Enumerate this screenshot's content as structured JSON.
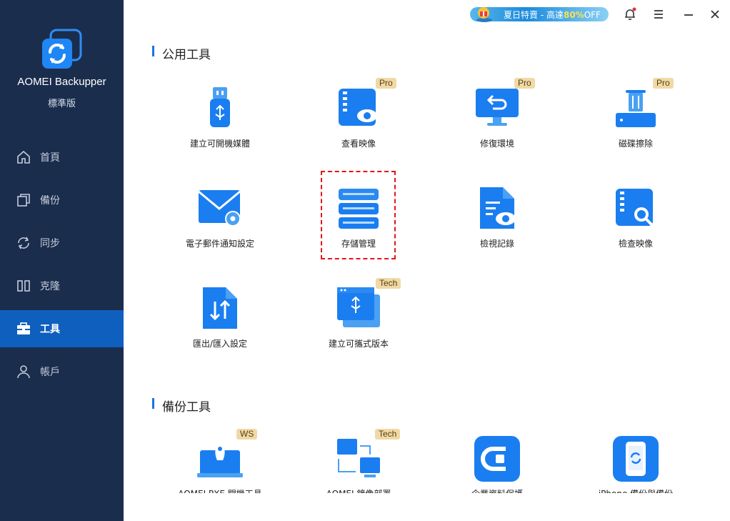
{
  "app": {
    "name": "AOMEI Backupper",
    "edition": "標準版"
  },
  "nav": {
    "items": [
      {
        "label": "首頁",
        "icon": "home-icon"
      },
      {
        "label": "備份",
        "icon": "backup-icon"
      },
      {
        "label": "同步",
        "icon": "sync-icon"
      },
      {
        "label": "克隆",
        "icon": "clone-icon"
      },
      {
        "label": "工具",
        "icon": "toolbox-icon",
        "active": true
      },
      {
        "label": "帳戶",
        "icon": "user-icon"
      }
    ]
  },
  "titlebar": {
    "promo_prefix": "夏日特賣 - 高達",
    "promo_highlight": "80%",
    "promo_suffix": "OFF"
  },
  "sections": {
    "common_title": "公用工具",
    "backup_title": "備份工具"
  },
  "common_tools": [
    {
      "label": "建立可開機媒體",
      "icon": "usb-drive-icon"
    },
    {
      "label": "查看映像",
      "icon": "view-image-icon",
      "badge": "Pro"
    },
    {
      "label": "修復環境",
      "icon": "recovery-env-icon",
      "badge": "Pro"
    },
    {
      "label": "磁碟擦除",
      "icon": "disk-wipe-icon",
      "badge": "Pro"
    },
    {
      "label": "電子郵件通知設定",
      "icon": "email-settings-icon"
    },
    {
      "label": "存儲管理",
      "icon": "storage-manage-icon"
    },
    {
      "label": "檢視記錄",
      "icon": "view-logs-icon"
    },
    {
      "label": "檢查映像",
      "icon": "check-image-icon"
    },
    {
      "label": "匯出/匯入設定",
      "icon": "export-import-icon"
    },
    {
      "label": "建立可攜式版本",
      "icon": "portable-version-icon",
      "badge": "Tech"
    }
  ],
  "backup_tools": [
    {
      "label": "AOMEI PXE 開機工具",
      "icon": "pxe-boot-icon",
      "badge": "WS"
    },
    {
      "label": "AOMEI 鏡像部署",
      "icon": "image-deploy-icon",
      "badge": "Tech"
    },
    {
      "label": "企業資料保護",
      "icon": "cyber-backup-icon"
    },
    {
      "label": "iPhone 備份與備份",
      "icon": "iphone-backup-icon"
    }
  ],
  "colors": {
    "sidebar": "#1b2d4c",
    "active_nav": "#0f5fbf",
    "accent": "#1a73e8",
    "badge": "#f0d9a6",
    "selection": "#e0171b"
  }
}
